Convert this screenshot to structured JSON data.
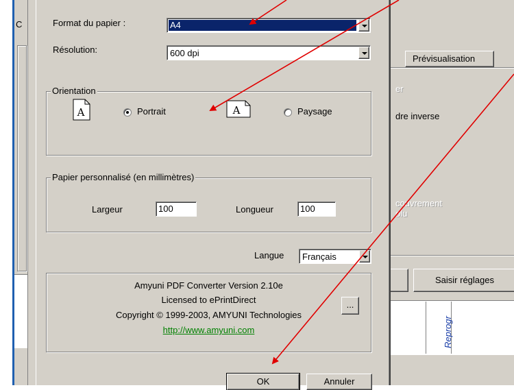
{
  "background_window": {
    "left_fragment": "C",
    "tab_preview": "Prévisualisation",
    "faded_lines": [
      "er",
      "dre inverse",
      "couvrement",
      "olu"
    ],
    "button_saisir": "Saisir réglages",
    "vertical_text": "Reprogr"
  },
  "dialog": {
    "format_label": "Format du papier :",
    "format_value": "A4",
    "resolution_label": "Résolution:",
    "resolution_value": "600 dpi",
    "orientation": {
      "legend": "Orientation",
      "portrait_label": "Portrait",
      "landscape_label": "Paysage",
      "selected": "portrait",
      "page_glyph": "A"
    },
    "custom_paper": {
      "legend": "Papier personnalisé (en millimètres)",
      "width_label": "Largeur",
      "width_value": "100",
      "length_label": "Longueur",
      "length_value": "100"
    },
    "language_label": "Langue",
    "language_value": "Français",
    "about": {
      "line1": "Amyuni PDF Converter Version 2.10e",
      "line2": "Licensed to ePrintDirect",
      "line3": "Copyright © 1999-2003, AMYUNI Technologies",
      "link": "http://www.amyuni.com",
      "more_button": "..."
    },
    "ok_button": "OK",
    "cancel_button": "Annuler"
  },
  "colors": {
    "face": "#d4d0c8",
    "selection": "#0a246a",
    "link": "#008000",
    "annotation_arrows": "#e00000",
    "window_border": "#1f5fb0"
  },
  "icons": [
    "dropdown-arrow-icon",
    "portrait-page-icon",
    "landscape-page-icon",
    "radio-icon"
  ]
}
